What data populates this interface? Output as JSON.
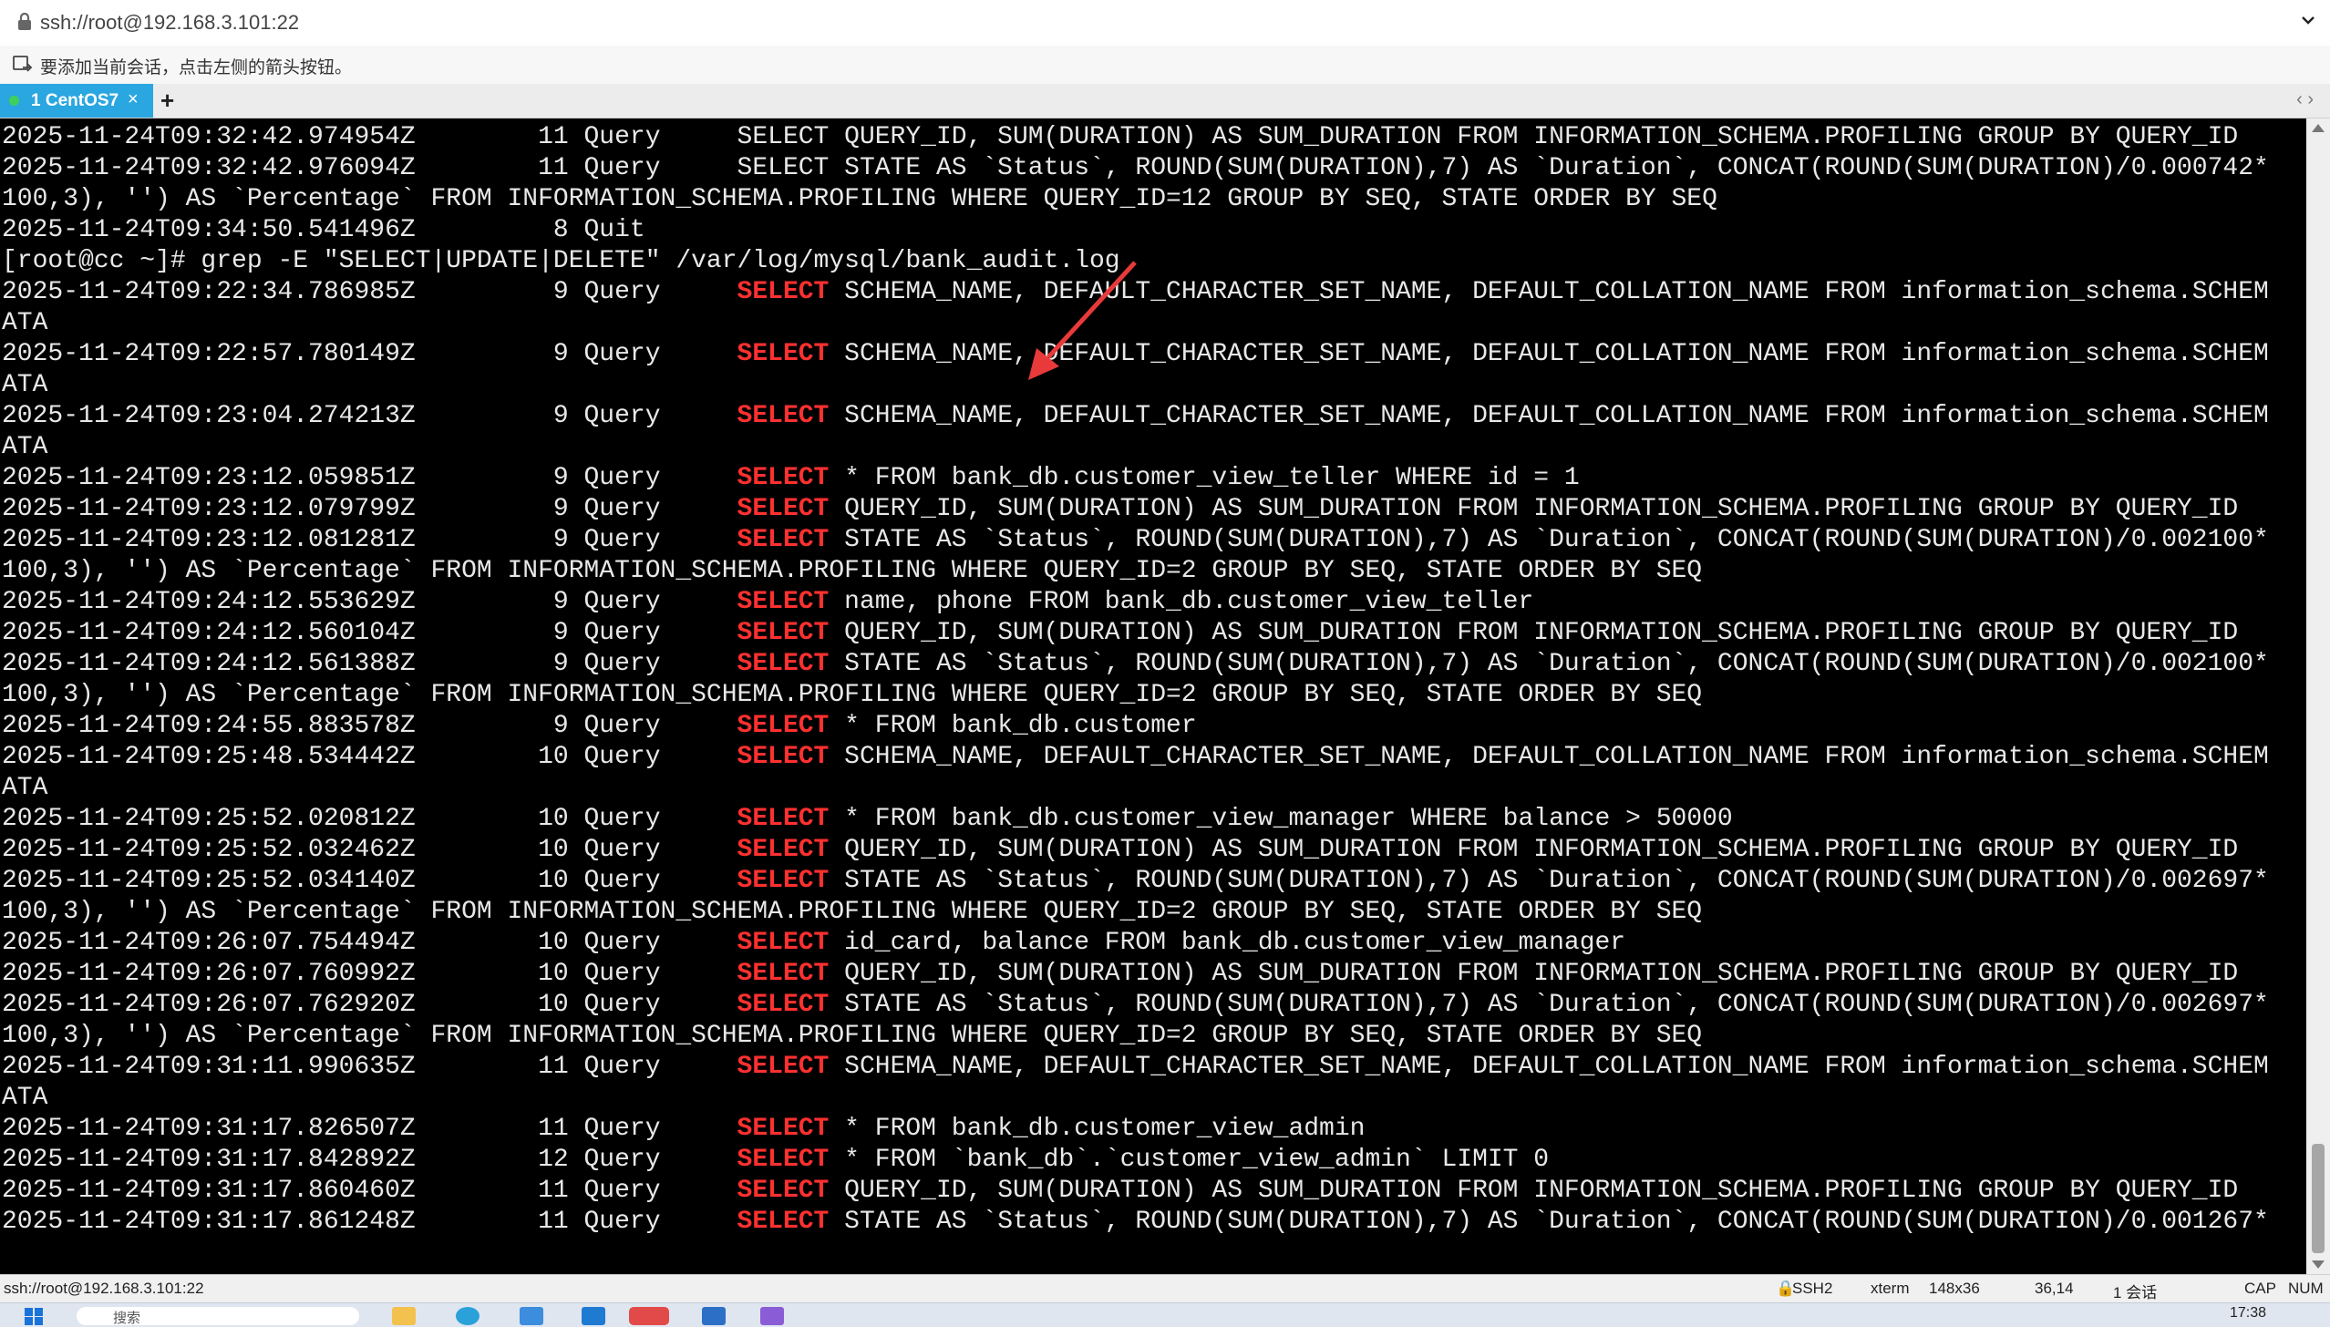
{
  "address_bar": {
    "url": "ssh://root@192.168.3.101:22"
  },
  "hint_bar": {
    "text": "要添加当前会话，点击左侧的箭头按钮。"
  },
  "tabs": [
    {
      "label": "1 CentOS7",
      "close": "×"
    }
  ],
  "tab_add": "+",
  "tab_nav": "‹  ›",
  "terminal": {
    "lines": [
      [
        {
          "t": "2025-11-24T09:32:42.974954Z        11 Query     SELECT QUERY_ID, SUM(DURATION) AS SUM_DURATION FROM INFORMATION_SCHEMA.PROFILING GROUP BY QUERY_ID"
        }
      ],
      [
        {
          "t": "2025-11-24T09:32:42.976094Z        11 Query     SELECT STATE AS `Status`, ROUND(SUM(DURATION),7) AS `Duration`, CONCAT(ROUND(SUM(DURATION)/0.000742*"
        }
      ],
      [
        {
          "t": "100,3), '') AS `Percentage` FROM INFORMATION_SCHEMA.PROFILING WHERE QUERY_ID=12 GROUP BY SEQ, STATE ORDER BY SEQ"
        }
      ],
      [
        {
          "t": "2025-11-24T09:34:50.541496Z         8 Quit"
        }
      ],
      [
        {
          "t": "[root@cc ~]# grep -E \"SELECT|UPDATE|DELETE\" /var/log/mysql/bank_audit.log"
        }
      ],
      [
        {
          "t": "2025-11-24T09:22:34.786985Z         9 Query     "
        },
        {
          "t": "SELECT",
          "k": 1
        },
        {
          "t": " SCHEMA_NAME, DEFAULT_CHARACTER_SET_NAME, DEFAULT_COLLATION_NAME FROM information_schema.SCHEM"
        }
      ],
      [
        {
          "t": "ATA"
        }
      ],
      [
        {
          "t": "2025-11-24T09:22:57.780149Z         9 Query     "
        },
        {
          "t": "SELECT",
          "k": 1
        },
        {
          "t": " SCHEMA_NAME, DEFAULT_CHARACTER_SET_NAME, DEFAULT_COLLATION_NAME FROM information_schema.SCHEM"
        }
      ],
      [
        {
          "t": "ATA"
        }
      ],
      [
        {
          "t": "2025-11-24T09:23:04.274213Z         9 Query     "
        },
        {
          "t": "SELECT",
          "k": 1
        },
        {
          "t": " SCHEMA_NAME, DEFAULT_CHARACTER_SET_NAME, DEFAULT_COLLATION_NAME FROM information_schema.SCHEM"
        }
      ],
      [
        {
          "t": "ATA"
        }
      ],
      [
        {
          "t": "2025-11-24T09:23:12.059851Z         9 Query     "
        },
        {
          "t": "SELECT",
          "k": 1
        },
        {
          "t": " * FROM bank_db.customer_view_teller WHERE id = 1"
        }
      ],
      [
        {
          "t": "2025-11-24T09:23:12.079799Z         9 Query     "
        },
        {
          "t": "SELECT",
          "k": 1
        },
        {
          "t": " QUERY_ID, SUM(DURATION) AS SUM_DURATION FROM INFORMATION_SCHEMA.PROFILING GROUP BY QUERY_ID"
        }
      ],
      [
        {
          "t": "2025-11-24T09:23:12.081281Z         9 Query     "
        },
        {
          "t": "SELECT",
          "k": 1
        },
        {
          "t": " STATE AS `Status`, ROUND(SUM(DURATION),7) AS `Duration`, CONCAT(ROUND(SUM(DURATION)/0.002100*"
        }
      ],
      [
        {
          "t": "100,3), '') AS `Percentage` FROM INFORMATION_SCHEMA.PROFILING WHERE QUERY_ID=2 GROUP BY SEQ, STATE ORDER BY SEQ"
        }
      ],
      [
        {
          "t": "2025-11-24T09:24:12.553629Z         9 Query     "
        },
        {
          "t": "SELECT",
          "k": 1
        },
        {
          "t": " name, phone FROM bank_db.customer_view_teller"
        }
      ],
      [
        {
          "t": "2025-11-24T09:24:12.560104Z         9 Query     "
        },
        {
          "t": "SELECT",
          "k": 1
        },
        {
          "t": " QUERY_ID, SUM(DURATION) AS SUM_DURATION FROM INFORMATION_SCHEMA.PROFILING GROUP BY QUERY_ID"
        }
      ],
      [
        {
          "t": "2025-11-24T09:24:12.561388Z         9 Query     "
        },
        {
          "t": "SELECT",
          "k": 1
        },
        {
          "t": " STATE AS `Status`, ROUND(SUM(DURATION),7) AS `Duration`, CONCAT(ROUND(SUM(DURATION)/0.002100*"
        }
      ],
      [
        {
          "t": "100,3), '') AS `Percentage` FROM INFORMATION_SCHEMA.PROFILING WHERE QUERY_ID=2 GROUP BY SEQ, STATE ORDER BY SEQ"
        }
      ],
      [
        {
          "t": "2025-11-24T09:24:55.883578Z         9 Query     "
        },
        {
          "t": "SELECT",
          "k": 1
        },
        {
          "t": " * FROM bank_db.customer"
        }
      ],
      [
        {
          "t": "2025-11-24T09:25:48.534442Z        10 Query     "
        },
        {
          "t": "SELECT",
          "k": 1
        },
        {
          "t": " SCHEMA_NAME, DEFAULT_CHARACTER_SET_NAME, DEFAULT_COLLATION_NAME FROM information_schema.SCHEM"
        }
      ],
      [
        {
          "t": "ATA"
        }
      ],
      [
        {
          "t": "2025-11-24T09:25:52.020812Z        10 Query     "
        },
        {
          "t": "SELECT",
          "k": 1
        },
        {
          "t": " * FROM bank_db.customer_view_manager WHERE balance > 50000"
        }
      ],
      [
        {
          "t": "2025-11-24T09:25:52.032462Z        10 Query     "
        },
        {
          "t": "SELECT",
          "k": 1
        },
        {
          "t": " QUERY_ID, SUM(DURATION) AS SUM_DURATION FROM INFORMATION_SCHEMA.PROFILING GROUP BY QUERY_ID"
        }
      ],
      [
        {
          "t": "2025-11-24T09:25:52.034140Z        10 Query     "
        },
        {
          "t": "SELECT",
          "k": 1
        },
        {
          "t": " STATE AS `Status`, ROUND(SUM(DURATION),7) AS `Duration`, CONCAT(ROUND(SUM(DURATION)/0.002697*"
        }
      ],
      [
        {
          "t": "100,3), '') AS `Percentage` FROM INFORMATION_SCHEMA.PROFILING WHERE QUERY_ID=2 GROUP BY SEQ, STATE ORDER BY SEQ"
        }
      ],
      [
        {
          "t": "2025-11-24T09:26:07.754494Z        10 Query     "
        },
        {
          "t": "SELECT",
          "k": 1
        },
        {
          "t": " id_card, balance FROM bank_db.customer_view_manager"
        }
      ],
      [
        {
          "t": "2025-11-24T09:26:07.760992Z        10 Query     "
        },
        {
          "t": "SELECT",
          "k": 1
        },
        {
          "t": " QUERY_ID, SUM(DURATION) AS SUM_DURATION FROM INFORMATION_SCHEMA.PROFILING GROUP BY QUERY_ID"
        }
      ],
      [
        {
          "t": "2025-11-24T09:26:07.762920Z        10 Query     "
        },
        {
          "t": "SELECT",
          "k": 1
        },
        {
          "t": " STATE AS `Status`, ROUND(SUM(DURATION),7) AS `Duration`, CONCAT(ROUND(SUM(DURATION)/0.002697*"
        }
      ],
      [
        {
          "t": "100,3), '') AS `Percentage` FROM INFORMATION_SCHEMA.PROFILING WHERE QUERY_ID=2 GROUP BY SEQ, STATE ORDER BY SEQ"
        }
      ],
      [
        {
          "t": "2025-11-24T09:31:11.990635Z        11 Query     "
        },
        {
          "t": "SELECT",
          "k": 1
        },
        {
          "t": " SCHEMA_NAME, DEFAULT_CHARACTER_SET_NAME, DEFAULT_COLLATION_NAME FROM information_schema.SCHEM"
        }
      ],
      [
        {
          "t": "ATA"
        }
      ],
      [
        {
          "t": "2025-11-24T09:31:17.826507Z        11 Query     "
        },
        {
          "t": "SELECT",
          "k": 1
        },
        {
          "t": " * FROM bank_db.customer_view_admin"
        }
      ],
      [
        {
          "t": "2025-11-24T09:31:17.842892Z        12 Query     "
        },
        {
          "t": "SELECT",
          "k": 1
        },
        {
          "t": " * FROM `bank_db`.`customer_view_admin` LIMIT 0"
        }
      ],
      [
        {
          "t": "2025-11-24T09:31:17.860460Z        11 Query     "
        },
        {
          "t": "SELECT",
          "k": 1
        },
        {
          "t": " QUERY_ID, SUM(DURATION) AS SUM_DURATION FROM INFORMATION_SCHEMA.PROFILING GROUP BY QUERY_ID"
        }
      ],
      [
        {
          "t": "2025-11-24T09:31:17.861248Z        11 Query     "
        },
        {
          "t": "SELECT",
          "k": 1
        },
        {
          "t": " STATE AS `Status`, ROUND(SUM(DURATION),7) AS `Duration`, CONCAT(ROUND(SUM(DURATION)/0.001267*"
        }
      ]
    ]
  },
  "status_bar": {
    "connection": "ssh://root@192.168.3.101:22",
    "protocol": "SSH2",
    "terminal_type": "xterm",
    "size": "148x36",
    "cursor": "36,14",
    "sessions": "1 会话",
    "cap": "CAP",
    "num": "NUM"
  },
  "taskbar": {
    "search_placeholder": "搜索",
    "time": "17:38"
  },
  "colors": {
    "tab_active": "#2aa6e0",
    "keyword": "#ff3030",
    "annotation_arrow": "#e83a3a",
    "terminal_bg": "#000000"
  }
}
